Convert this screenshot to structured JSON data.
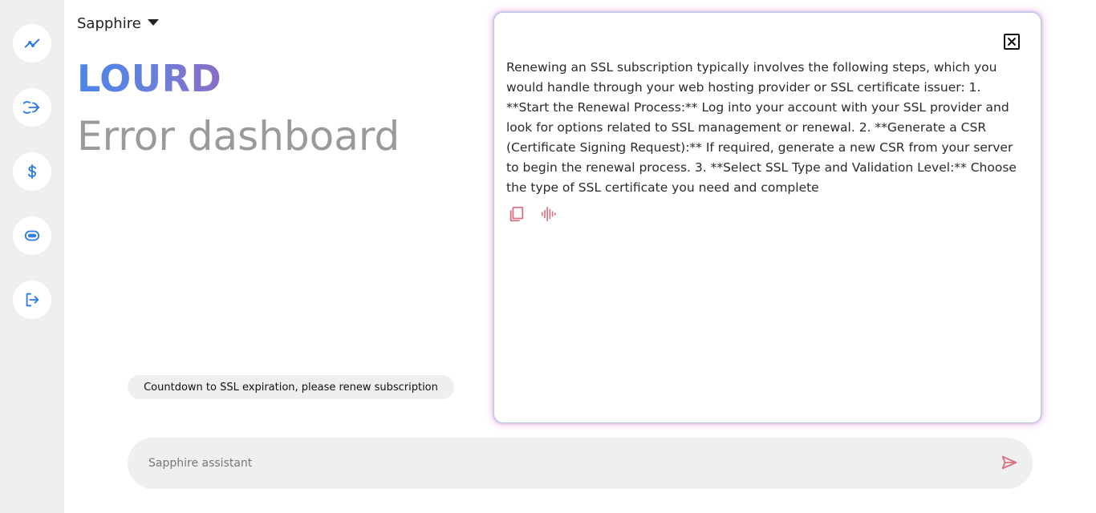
{
  "app": {
    "brand_name": "Sapphire",
    "logo_text": "LOURD",
    "page_title": "Error dashboard"
  },
  "sidebar": {
    "items": [
      {
        "name": "analytics",
        "icon": "trending-line-icon"
      },
      {
        "name": "login",
        "icon": "login-arrow-icon"
      },
      {
        "name": "billing",
        "icon": "dollar-icon"
      },
      {
        "name": "assistant",
        "icon": "robot-icon"
      },
      {
        "name": "logout",
        "icon": "logout-icon"
      }
    ],
    "accent_color": "#2f7be5"
  },
  "notice": {
    "text": "Countdown to SSL expiration, please renew subscription"
  },
  "chat_panel": {
    "message": "Renewing an SSL subscription typically involves the following steps, which you would handle through your web hosting provider or SSL certificate issuer: 1. **Start the Renewal Process:** Log into your account with your SSL provider and look for options related to SSL management or renewal. 2. **Generate a CSR (Certificate Signing Request):** If required, generate a new CSR from your server to begin the renewal process. 3. **Select SSL Type and Validation Level:** Choose the type of SSL certificate you need and complete",
    "action_color": "#d9707f"
  },
  "composer": {
    "placeholder": "Sapphire assistant",
    "value": ""
  }
}
